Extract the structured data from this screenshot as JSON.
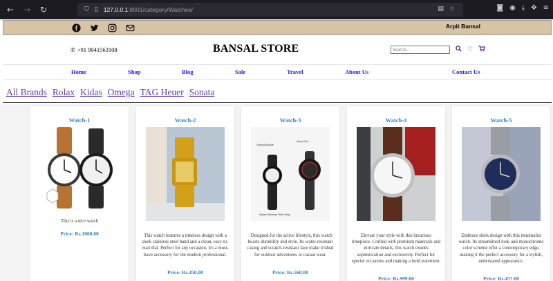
{
  "browser": {
    "url_prefix": "127.0.0.1",
    "url_rest": ":8001/category/Watches/"
  },
  "topbar": {
    "social_icons": [
      "facebook-icon",
      "twitter-icon",
      "instagram-icon",
      "email-icon"
    ],
    "owner_name": "Arpit Bansal"
  },
  "header": {
    "phone": "+91 9041563108",
    "store_name": "BANSAL STORE",
    "search_placeholder": "Search..."
  },
  "nav": {
    "items": [
      "Home",
      "Shop",
      "Blog",
      "Sale",
      "Travel",
      "About Us",
      "Contact Us"
    ]
  },
  "brands": {
    "items": [
      "All Brands",
      "Rolax",
      "Kidas",
      "Omega",
      "TAG Heuer",
      "Sonata"
    ]
  },
  "image_text": {
    "watch3_label_a": "Strong Buckle",
    "watch3_label_b": "Alloy Dial",
    "watch3_label_c": "Stylish Stainless Steel Strap"
  },
  "products": [
    {
      "title": "Watch-1",
      "description": "This is a nice watch",
      "price": "Price: Rs.1000.00"
    },
    {
      "title": "Watch-2",
      "description": "This watch features a timeless design with a sleek stainless steel band and a clean, easy-to-read dial. Perfect for any occasion, it's a must-have accessory for the modern professional.",
      "price": "Price: Rs.450.00"
    },
    {
      "title": "Watch-3",
      "description": ": Designed for the active lifestyle, this watch boasts durability and style. Its water-resistant casing and scratch-resistant face make it ideal for outdoor adventures or casual wear.",
      "price": "Price: Rs.560.00"
    },
    {
      "title": "Watch-4",
      "description": "Elevate your style with this luxurious timepiece. Crafted with premium materials and intricate details, this watch exudes sophistication and exclusivity. Perfect for special occasions and making a bold statement.",
      "price": "Price: Rs.999.00"
    },
    {
      "title": "Watch-5",
      "description": "Embrace sleek design with this minimalist watch. Its streamlined look and monochrome color scheme offer a contemporary edge, making it the perfect accessory for a stylish, understated appearance.",
      "price": "Price: Rs.457.00"
    }
  ]
}
